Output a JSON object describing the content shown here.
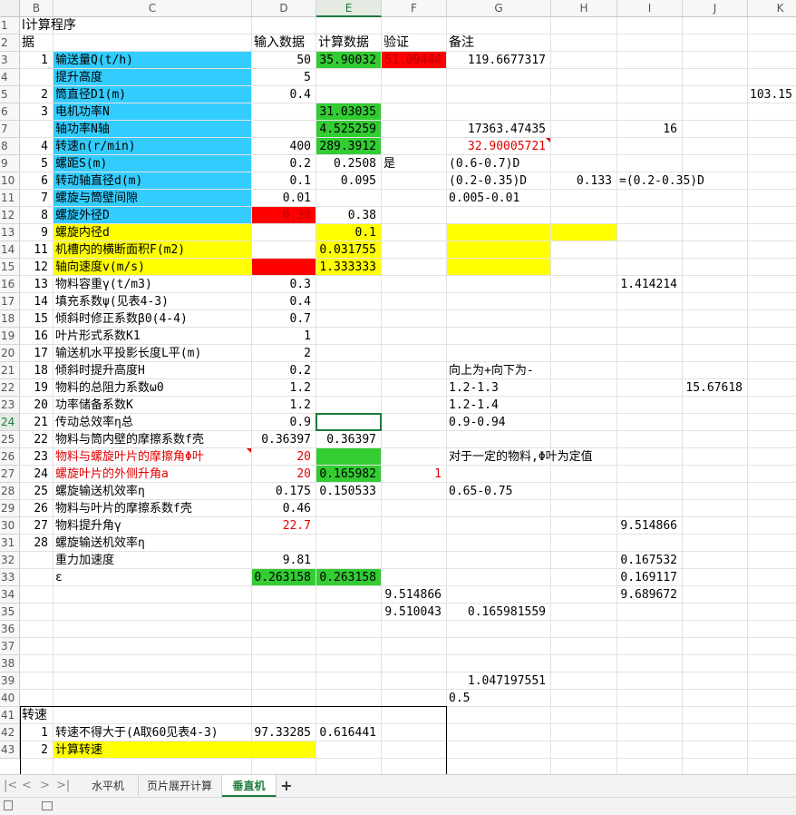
{
  "columns": [
    "B",
    "C",
    "D",
    "E",
    "F",
    "G",
    "H",
    "I",
    "J",
    "K"
  ],
  "selected_column": "E",
  "rows": [
    "1",
    "2",
    "3",
    "4",
    "5",
    "6",
    "7",
    "8",
    "9",
    "10",
    "11",
    "12",
    "13",
    "14",
    "15",
    "16",
    "17",
    "18",
    "19",
    "20",
    "21",
    "22",
    "23",
    "24",
    "25",
    "26",
    "27",
    "28",
    "29",
    "30",
    "31",
    "32",
    "33",
    "34",
    "35",
    "36",
    "37",
    "38",
    "39",
    "40",
    "41",
    "42",
    "43"
  ],
  "selected_row": "24",
  "colors": {
    "cyan": "#33ccff",
    "green": "#33cc33",
    "red": "#ff0000",
    "yellow": "#ffff00",
    "accent": "#1a7a3a",
    "red_text": "#e00000"
  },
  "cells": {
    "r1": {
      "B": "l计算程序"
    },
    "r2": {
      "B": "据",
      "D": "输入数据",
      "E": "计算数据",
      "F": "验证",
      "G": "备注"
    },
    "r3": {
      "B": "1",
      "C": "输送量Q(t/h)",
      "D": "50",
      "E": "35.90032",
      "F": "51.09444",
      "G": "119.6677317"
    },
    "r4": {
      "C": "提升高度",
      "D": "5"
    },
    "r5": {
      "B": "2",
      "C": "筒直径D1(m)",
      "D": "0.4",
      "K": "103.15"
    },
    "r6": {
      "B": "3",
      "C": "电机功率N",
      "E": "31.03035"
    },
    "r7": {
      "C": "轴功率N轴",
      "E": "4.525259",
      "G": "17363.47435",
      "I": "16"
    },
    "r8": {
      "B": "4",
      "C": "转速n(r/min)",
      "D": "400",
      "E": "289.3912",
      "G": "32.90005721"
    },
    "r9": {
      "B": "5",
      "C": "螺距S(m)",
      "D": "0.2",
      "E": "0.2508",
      "F": "是",
      "G": "(0.6-0.7)D"
    },
    "r10": {
      "B": "6",
      "C": "转动轴直径d(m)",
      "D": "0.1",
      "E": "0.095",
      "G": "(0.2-0.35)D",
      "H": "0.133",
      "I": "=(0.2-0.35)D"
    },
    "r11": {
      "B": "7",
      "C": "螺旋与筒壁间隙",
      "D": "0.01",
      "G": "0.005-0.01"
    },
    "r12": {
      "B": "8",
      "C": "螺旋外径D",
      "D": "0.38",
      "E": "0.38"
    },
    "r13": {
      "B": "9",
      "C": "螺旋内径d",
      "E": "0.1"
    },
    "r14": {
      "B": "11",
      "C": "机槽内的横断面积F(m2)",
      "E": "0.031755"
    },
    "r15": {
      "B": "12",
      "C": "轴向速度v(m/s)",
      "E": "1.333333"
    },
    "r16": {
      "B": "13",
      "C": "物料容重γ(t/m3)",
      "D": "0.3",
      "I": "1.414214"
    },
    "r17": {
      "B": "14",
      "C": "填充系数ψ(见表4-3)",
      "D": "0.4"
    },
    "r18": {
      "B": "15",
      "C": "倾斜时修正系数β0(4-4)",
      "D": "0.7"
    },
    "r19": {
      "B": "16",
      "C": "叶片形式系数K1",
      "D": "1"
    },
    "r20": {
      "B": "17",
      "C": "输送机水平投影长度L平(m)",
      "D": "2"
    },
    "r21": {
      "B": "18",
      "C": "倾斜时提升高度H",
      "D": "0.2",
      "G": "向上为+向下为-"
    },
    "r22": {
      "B": "19",
      "C": "物料的总阻力系数ω0",
      "D": "1.2",
      "G": "1.2-1.3",
      "J": "15.67618"
    },
    "r23": {
      "B": "20",
      "C": "功率储备系数K",
      "D": "1.2",
      "G": "1.2-1.4"
    },
    "r24": {
      "B": "21",
      "C": "传动总效率η总",
      "D": "0.9",
      "G": "0.9-0.94"
    },
    "r25": {
      "B": "22",
      "C": "物料与筒内壁的摩擦系数f壳",
      "D": "0.36397",
      "E": "0.36397"
    },
    "r26": {
      "B": "23",
      "C": "物料与螺旋叶片的摩擦角Φ叶",
      "D": "20",
      "G": "对于一定的物料,Φ叶为定值"
    },
    "r27": {
      "B": "24",
      "C": "螺旋叶片的外侧升角a",
      "D": "20",
      "E": "0.165982",
      "F": "1"
    },
    "r28": {
      "B": "25",
      "C": "螺旋输送机效率η",
      "D": "0.175",
      "E": "0.150533",
      "G": "0.65-0.75"
    },
    "r29": {
      "B": "26",
      "C": "物料与叶片的摩擦系数f壳",
      "D": "0.46"
    },
    "r30": {
      "B": "27",
      "C": "物料提升角γ",
      "D": "22.7",
      "I": "9.514866"
    },
    "r31": {
      "B": "28",
      "C": "螺旋输送机效率η"
    },
    "r32": {
      "C": "重力加速度",
      "D": "9.81",
      "I": "0.167532"
    },
    "r33": {
      "C": "ε",
      "D": "0.263158",
      "E": "0.263158",
      "I": "0.169117"
    },
    "r34": {
      "F": "9.514866",
      "I": "9.689672"
    },
    "r35": {
      "F": "9.510043",
      "G": "0.165981559"
    },
    "r39": {
      "G": "1.047197551"
    },
    "r40": {
      "G": "0.5"
    },
    "r41": {
      "B": "转速"
    },
    "r42": {
      "B": "1",
      "C": "转速不得大于(A取60见表4-3)",
      "D": "97.33285",
      "E": "0.616441"
    },
    "r43": {
      "B": "2",
      "C": "计算转速"
    }
  },
  "sheet_tabs": [
    "水平机",
    "页片展开计算",
    "垂直机"
  ],
  "active_tab": "垂直机",
  "nav_icons": [
    "first-sheet-icon",
    "prev-sheet-icon",
    "next-sheet-icon",
    "last-sheet-icon"
  ],
  "add_sheet": "+"
}
